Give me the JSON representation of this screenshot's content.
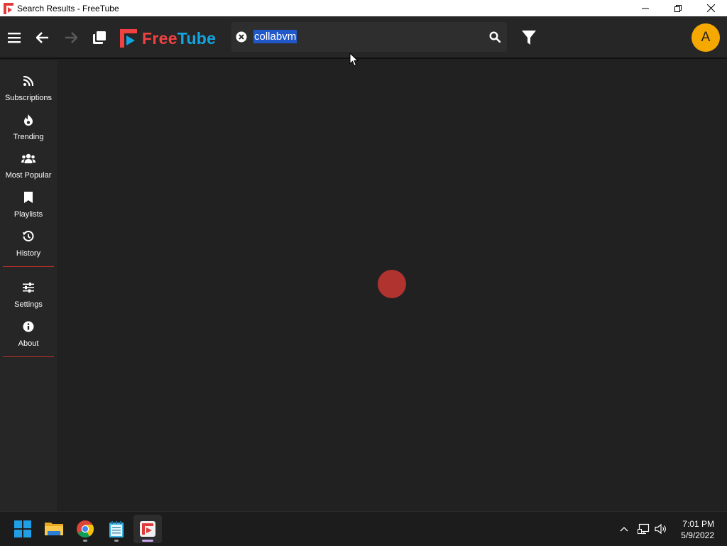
{
  "window": {
    "title": "Search Results - FreeTube"
  },
  "header": {
    "logo": {
      "free": "Free",
      "tube": "Tube"
    },
    "search": {
      "query": "collabvm"
    },
    "avatar_letter": "A"
  },
  "sidebar": {
    "items": [
      {
        "label": "Subscriptions",
        "icon": "rss-icon"
      },
      {
        "label": "Trending",
        "icon": "fire-icon"
      },
      {
        "label": "Most Popular",
        "icon": "users-icon"
      },
      {
        "label": "Playlists",
        "icon": "bookmark-icon"
      },
      {
        "label": "History",
        "icon": "history-icon"
      },
      {
        "label": "Settings",
        "icon": "sliders-icon"
      },
      {
        "label": "About",
        "icon": "info-icon"
      }
    ]
  },
  "taskbar": {
    "apps": [
      "start-icon",
      "file-explorer-icon",
      "chrome-icon",
      "notepad-icon",
      "freetube-icon"
    ],
    "clock": {
      "time": "7:01 PM",
      "date": "5/9/2022"
    }
  },
  "colors": {
    "accent": "#b03330",
    "avatar": "#f5a800",
    "logo_red": "#f04242",
    "logo_blue": "#14a4df",
    "selection": "#2058c9"
  }
}
